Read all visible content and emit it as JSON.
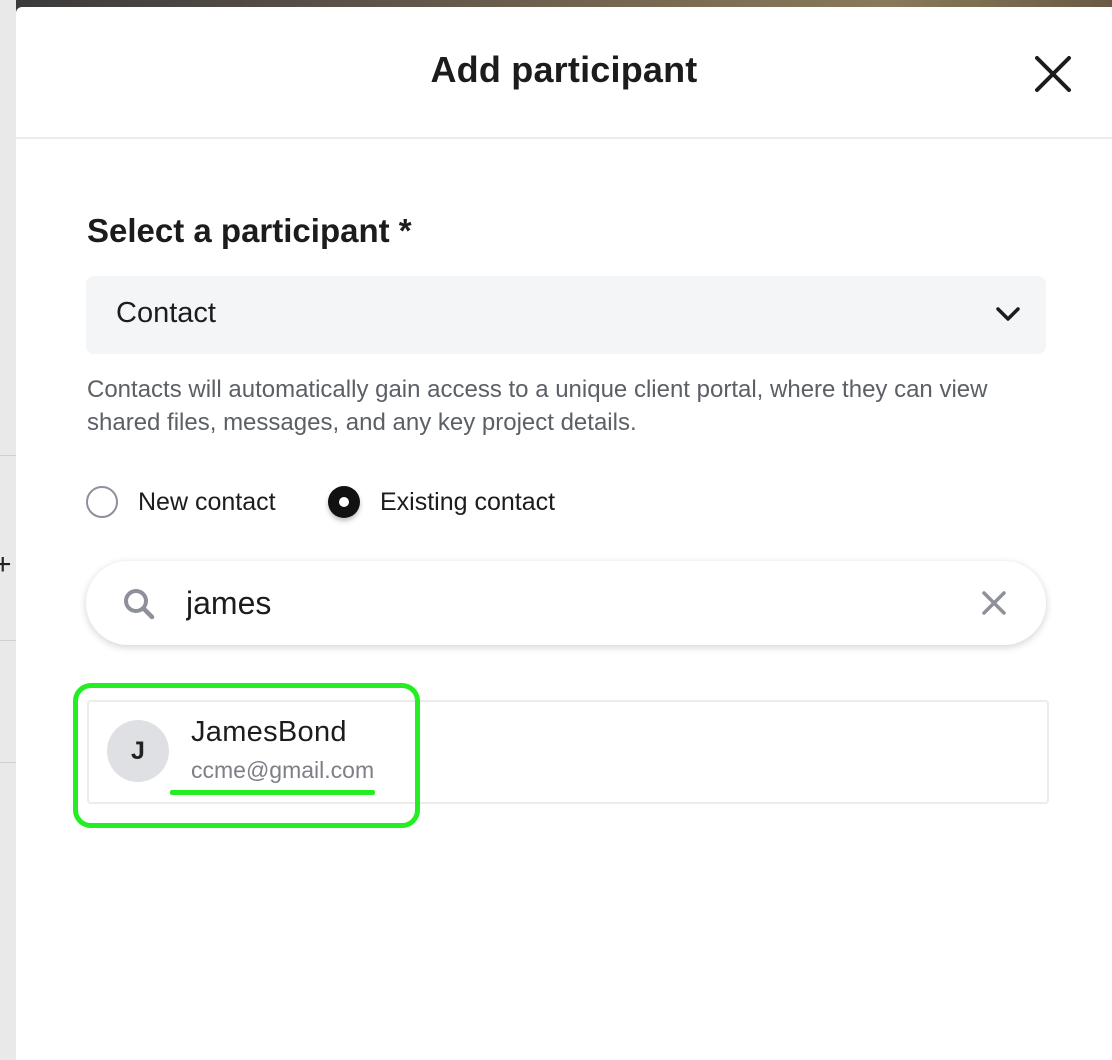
{
  "modal": {
    "title": "Add participant"
  },
  "form": {
    "label": "Select a participant *",
    "select_value": "Contact",
    "help_text": "Contacts will automatically gain access to a unique client portal, where they can view shared files, messages, and any key project details.",
    "radio_options": [
      {
        "label": "New contact",
        "checked": false
      },
      {
        "label": "Existing contact",
        "checked": true
      }
    ]
  },
  "search": {
    "value": "james"
  },
  "results": [
    {
      "initial": "J",
      "name": "JamesBond",
      "email": "ccme@gmail.com"
    }
  ],
  "colors": {
    "highlight": "#22ee22",
    "radio_checked": "#111111",
    "select_bg": "#f4f5f7"
  },
  "icons": [
    "close-icon",
    "chevron-down-icon",
    "search-icon",
    "clear-icon"
  ]
}
